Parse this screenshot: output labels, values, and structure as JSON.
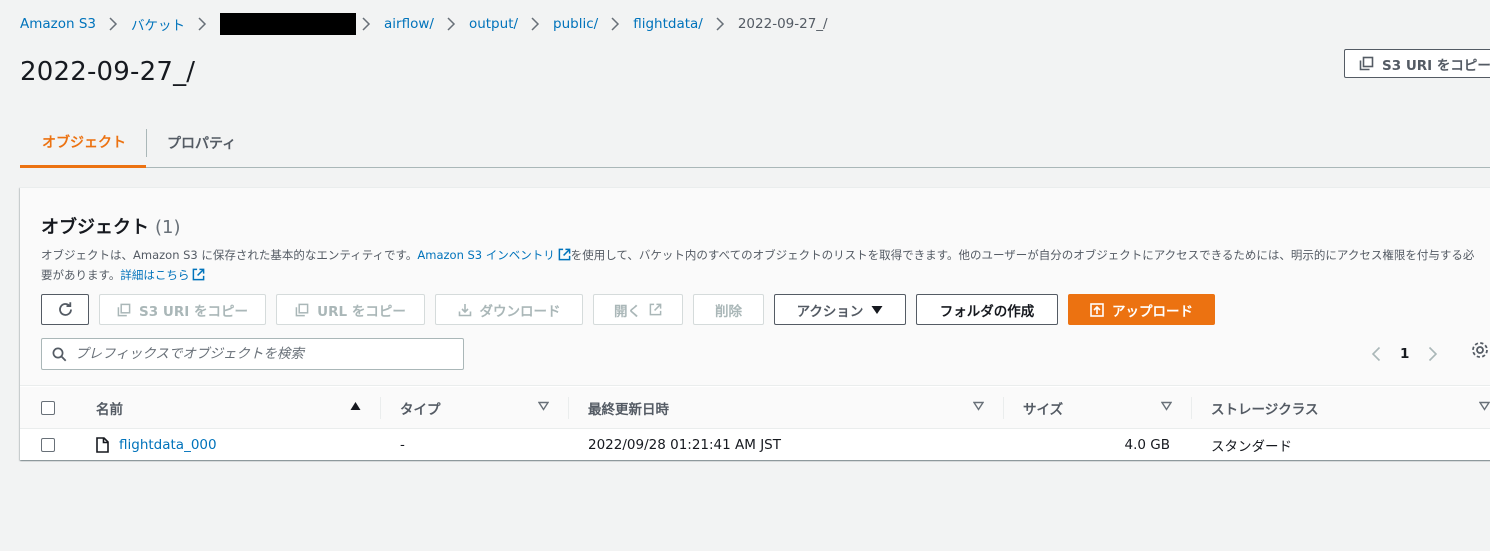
{
  "breadcrumb": {
    "items": [
      "Amazon S3",
      "バケット",
      "airflow/",
      "output/",
      "public/",
      "flightdata/"
    ],
    "current": "2022-09-27_/"
  },
  "page": {
    "title": "2022-09-27_/",
    "copy_uri_label": "S3 URI をコピー"
  },
  "tabs": [
    {
      "label": "オブジェクト",
      "active": true
    },
    {
      "label": "プロパティ",
      "active": false
    }
  ],
  "objects": {
    "heading": "オブジェクト",
    "count": "(1)",
    "desc_before": "オブジェクトは、Amazon S3 に保存された基本的なエンティティです。",
    "desc_link": "Amazon S3 インベントリ",
    "desc_after": "を使用して、バケット内のすべてのオブジェクトのリストを取得できます。他のユーザーが自分のオブジェクトにアクセスできるためには、明示的にアクセス権限を付与する必要があります。",
    "desc_more": "詳細はこちら"
  },
  "toolbar": {
    "copy_s3_uri": "S3 URI をコピー",
    "copy_url": "URL をコピー",
    "download": "ダウンロード",
    "open": "開く",
    "delete": "削除",
    "actions": "アクション",
    "create_folder": "フォルダの作成",
    "upload": "アップロード"
  },
  "search": {
    "placeholder": "プレフィックスでオブジェクトを検索"
  },
  "pagination": {
    "page": "1"
  },
  "table": {
    "columns": [
      "名前",
      "タイプ",
      "最終更新日時",
      "サイズ",
      "ストレージクラス"
    ],
    "rows": [
      {
        "name": "flightdata_000",
        "type": "-",
        "modified": "2022/09/28 01:21:41 AM JST",
        "size": "4.0 GB",
        "storage_class": "スタンダード"
      }
    ]
  },
  "colors": {
    "accent": "#ec7211",
    "link": "#0073bb",
    "text": "#16191f",
    "muted": "#545b64"
  }
}
